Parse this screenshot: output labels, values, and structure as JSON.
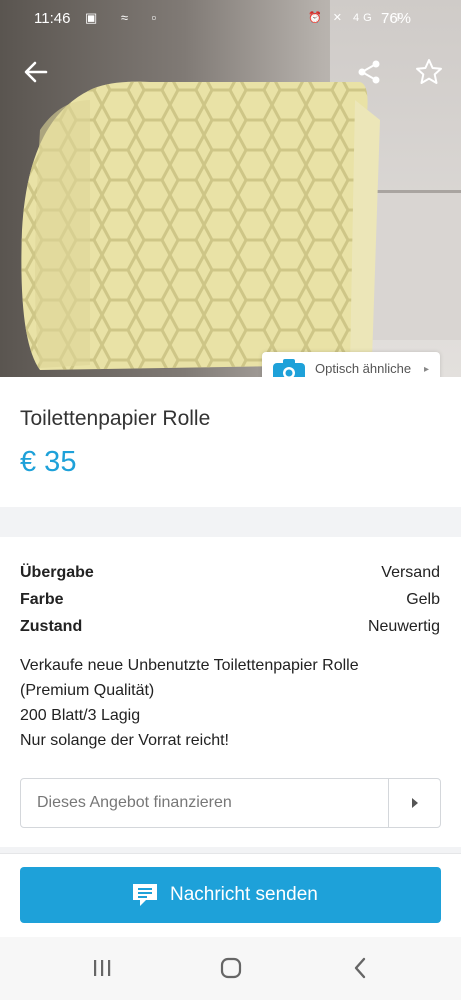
{
  "status": {
    "time": "11:46",
    "battery": "76%"
  },
  "hero": {
    "visual_search_label": "Optisch ähnliche"
  },
  "listing": {
    "title": "Toilettenpapier Rolle",
    "price": "€ 35"
  },
  "details": [
    {
      "key": "Übergabe",
      "value": "Versand"
    },
    {
      "key": "Farbe",
      "value": "Gelb"
    },
    {
      "key": "Zustand",
      "value": "Neuwertig"
    }
  ],
  "description": [
    "Verkaufe neue Unbenutzte Toilettenpapier Rolle",
    "(Premium Qualität)",
    "200 Blatt/3 Lagig",
    "Nur solange der Vorrat reicht!"
  ],
  "finance": {
    "placeholder": "Dieses Angebot finanzieren"
  },
  "actions": {
    "send_message": "Nachricht senden"
  },
  "colors": {
    "accent": "#1ea1d9",
    "roll": "#e9e2a6"
  },
  "icons": [
    "back-arrow-icon",
    "share-icon",
    "star-icon",
    "camera-icon",
    "chat-icon",
    "chevron-right-icon",
    "recents-icon",
    "home-icon",
    "back-icon"
  ]
}
